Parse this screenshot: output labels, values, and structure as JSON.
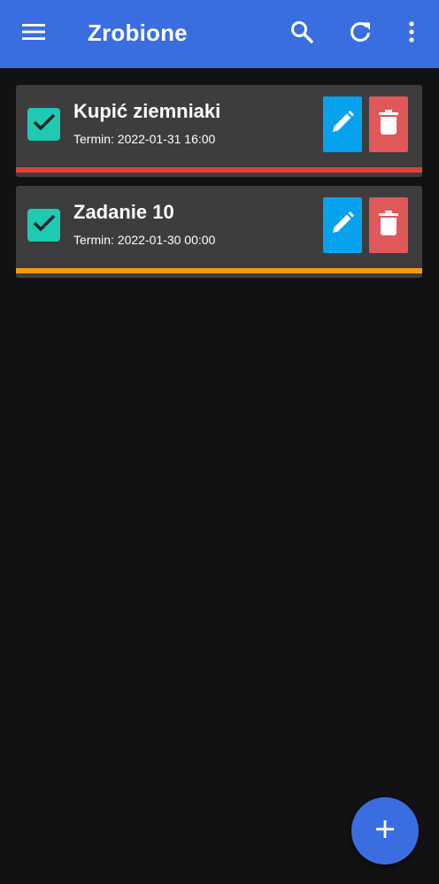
{
  "appbar": {
    "title": "Zrobione",
    "background": "#3a6ee0",
    "icons": {
      "menu": "menu-icon",
      "search": "search-icon",
      "refresh": "refresh-icon",
      "more": "more-vert-icon"
    }
  },
  "tasks": [
    {
      "title": "Kupić ziemniaki",
      "due": "Termin: 2022-01-31 16:00",
      "checked": true,
      "priority_color": "#e0413c"
    },
    {
      "title": "Zadanie 10",
      "due": "Termin: 2022-01-30 00:00",
      "checked": true,
      "priority_color": "#f39c12"
    }
  ],
  "colors": {
    "checkbox": "#20c9b1",
    "edit_button": "#06a2ee",
    "delete_button": "#e0585a",
    "card_background": "#3d3d3d",
    "page_background": "#121212"
  },
  "fab": {
    "icon": "plus-icon"
  }
}
